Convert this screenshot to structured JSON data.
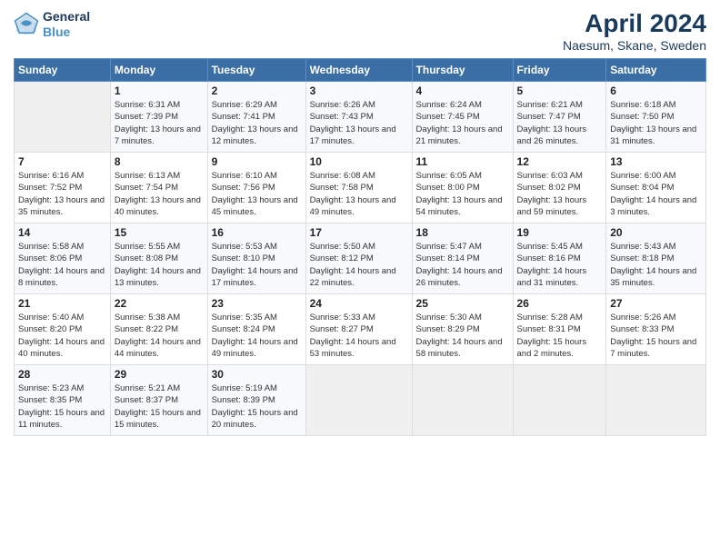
{
  "header": {
    "logo_line1": "General",
    "logo_line2": "Blue",
    "month": "April 2024",
    "location": "Naesum, Skane, Sweden"
  },
  "weekdays": [
    "Sunday",
    "Monday",
    "Tuesday",
    "Wednesday",
    "Thursday",
    "Friday",
    "Saturday"
  ],
  "weeks": [
    [
      {
        "day": "",
        "sunrise": "",
        "sunset": "",
        "daylight": ""
      },
      {
        "day": "1",
        "sunrise": "Sunrise: 6:31 AM",
        "sunset": "Sunset: 7:39 PM",
        "daylight": "Daylight: 13 hours and 7 minutes."
      },
      {
        "day": "2",
        "sunrise": "Sunrise: 6:29 AM",
        "sunset": "Sunset: 7:41 PM",
        "daylight": "Daylight: 13 hours and 12 minutes."
      },
      {
        "day": "3",
        "sunrise": "Sunrise: 6:26 AM",
        "sunset": "Sunset: 7:43 PM",
        "daylight": "Daylight: 13 hours and 17 minutes."
      },
      {
        "day": "4",
        "sunrise": "Sunrise: 6:24 AM",
        "sunset": "Sunset: 7:45 PM",
        "daylight": "Daylight: 13 hours and 21 minutes."
      },
      {
        "day": "5",
        "sunrise": "Sunrise: 6:21 AM",
        "sunset": "Sunset: 7:47 PM",
        "daylight": "Daylight: 13 hours and 26 minutes."
      },
      {
        "day": "6",
        "sunrise": "Sunrise: 6:18 AM",
        "sunset": "Sunset: 7:50 PM",
        "daylight": "Daylight: 13 hours and 31 minutes."
      }
    ],
    [
      {
        "day": "7",
        "sunrise": "Sunrise: 6:16 AM",
        "sunset": "Sunset: 7:52 PM",
        "daylight": "Daylight: 13 hours and 35 minutes."
      },
      {
        "day": "8",
        "sunrise": "Sunrise: 6:13 AM",
        "sunset": "Sunset: 7:54 PM",
        "daylight": "Daylight: 13 hours and 40 minutes."
      },
      {
        "day": "9",
        "sunrise": "Sunrise: 6:10 AM",
        "sunset": "Sunset: 7:56 PM",
        "daylight": "Daylight: 13 hours and 45 minutes."
      },
      {
        "day": "10",
        "sunrise": "Sunrise: 6:08 AM",
        "sunset": "Sunset: 7:58 PM",
        "daylight": "Daylight: 13 hours and 49 minutes."
      },
      {
        "day": "11",
        "sunrise": "Sunrise: 6:05 AM",
        "sunset": "Sunset: 8:00 PM",
        "daylight": "Daylight: 13 hours and 54 minutes."
      },
      {
        "day": "12",
        "sunrise": "Sunrise: 6:03 AM",
        "sunset": "Sunset: 8:02 PM",
        "daylight": "Daylight: 13 hours and 59 minutes."
      },
      {
        "day": "13",
        "sunrise": "Sunrise: 6:00 AM",
        "sunset": "Sunset: 8:04 PM",
        "daylight": "Daylight: 14 hours and 3 minutes."
      }
    ],
    [
      {
        "day": "14",
        "sunrise": "Sunrise: 5:58 AM",
        "sunset": "Sunset: 8:06 PM",
        "daylight": "Daylight: 14 hours and 8 minutes."
      },
      {
        "day": "15",
        "sunrise": "Sunrise: 5:55 AM",
        "sunset": "Sunset: 8:08 PM",
        "daylight": "Daylight: 14 hours and 13 minutes."
      },
      {
        "day": "16",
        "sunrise": "Sunrise: 5:53 AM",
        "sunset": "Sunset: 8:10 PM",
        "daylight": "Daylight: 14 hours and 17 minutes."
      },
      {
        "day": "17",
        "sunrise": "Sunrise: 5:50 AM",
        "sunset": "Sunset: 8:12 PM",
        "daylight": "Daylight: 14 hours and 22 minutes."
      },
      {
        "day": "18",
        "sunrise": "Sunrise: 5:47 AM",
        "sunset": "Sunset: 8:14 PM",
        "daylight": "Daylight: 14 hours and 26 minutes."
      },
      {
        "day": "19",
        "sunrise": "Sunrise: 5:45 AM",
        "sunset": "Sunset: 8:16 PM",
        "daylight": "Daylight: 14 hours and 31 minutes."
      },
      {
        "day": "20",
        "sunrise": "Sunrise: 5:43 AM",
        "sunset": "Sunset: 8:18 PM",
        "daylight": "Daylight: 14 hours and 35 minutes."
      }
    ],
    [
      {
        "day": "21",
        "sunrise": "Sunrise: 5:40 AM",
        "sunset": "Sunset: 8:20 PM",
        "daylight": "Daylight: 14 hours and 40 minutes."
      },
      {
        "day": "22",
        "sunrise": "Sunrise: 5:38 AM",
        "sunset": "Sunset: 8:22 PM",
        "daylight": "Daylight: 14 hours and 44 minutes."
      },
      {
        "day": "23",
        "sunrise": "Sunrise: 5:35 AM",
        "sunset": "Sunset: 8:24 PM",
        "daylight": "Daylight: 14 hours and 49 minutes."
      },
      {
        "day": "24",
        "sunrise": "Sunrise: 5:33 AM",
        "sunset": "Sunset: 8:27 PM",
        "daylight": "Daylight: 14 hours and 53 minutes."
      },
      {
        "day": "25",
        "sunrise": "Sunrise: 5:30 AM",
        "sunset": "Sunset: 8:29 PM",
        "daylight": "Daylight: 14 hours and 58 minutes."
      },
      {
        "day": "26",
        "sunrise": "Sunrise: 5:28 AM",
        "sunset": "Sunset: 8:31 PM",
        "daylight": "Daylight: 15 hours and 2 minutes."
      },
      {
        "day": "27",
        "sunrise": "Sunrise: 5:26 AM",
        "sunset": "Sunset: 8:33 PM",
        "daylight": "Daylight: 15 hours and 7 minutes."
      }
    ],
    [
      {
        "day": "28",
        "sunrise": "Sunrise: 5:23 AM",
        "sunset": "Sunset: 8:35 PM",
        "daylight": "Daylight: 15 hours and 11 minutes."
      },
      {
        "day": "29",
        "sunrise": "Sunrise: 5:21 AM",
        "sunset": "Sunset: 8:37 PM",
        "daylight": "Daylight: 15 hours and 15 minutes."
      },
      {
        "day": "30",
        "sunrise": "Sunrise: 5:19 AM",
        "sunset": "Sunset: 8:39 PM",
        "daylight": "Daylight: 15 hours and 20 minutes."
      },
      {
        "day": "",
        "sunrise": "",
        "sunset": "",
        "daylight": ""
      },
      {
        "day": "",
        "sunrise": "",
        "sunset": "",
        "daylight": ""
      },
      {
        "day": "",
        "sunrise": "",
        "sunset": "",
        "daylight": ""
      },
      {
        "day": "",
        "sunrise": "",
        "sunset": "",
        "daylight": ""
      }
    ]
  ]
}
